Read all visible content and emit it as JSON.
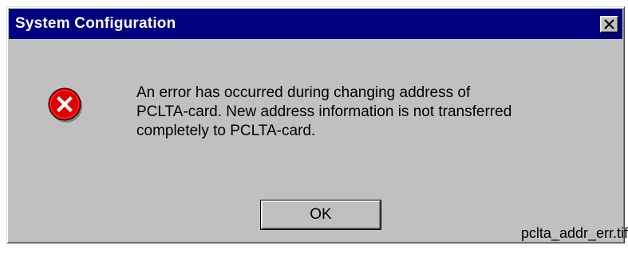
{
  "window": {
    "title": "System Configuration",
    "title_bar_color": "#000080",
    "close_icon": "close-icon"
  },
  "message": {
    "icon": "error-icon",
    "icon_color": "#e00000",
    "lines": [
      "An error has occurred during changing address of",
      "PCLTA-card. New address information is not transferred",
      "completely to PCLTA-card."
    ]
  },
  "buttons": {
    "ok_label": "OK"
  },
  "caption": {
    "filename": "pclta_addr_err.tif"
  }
}
